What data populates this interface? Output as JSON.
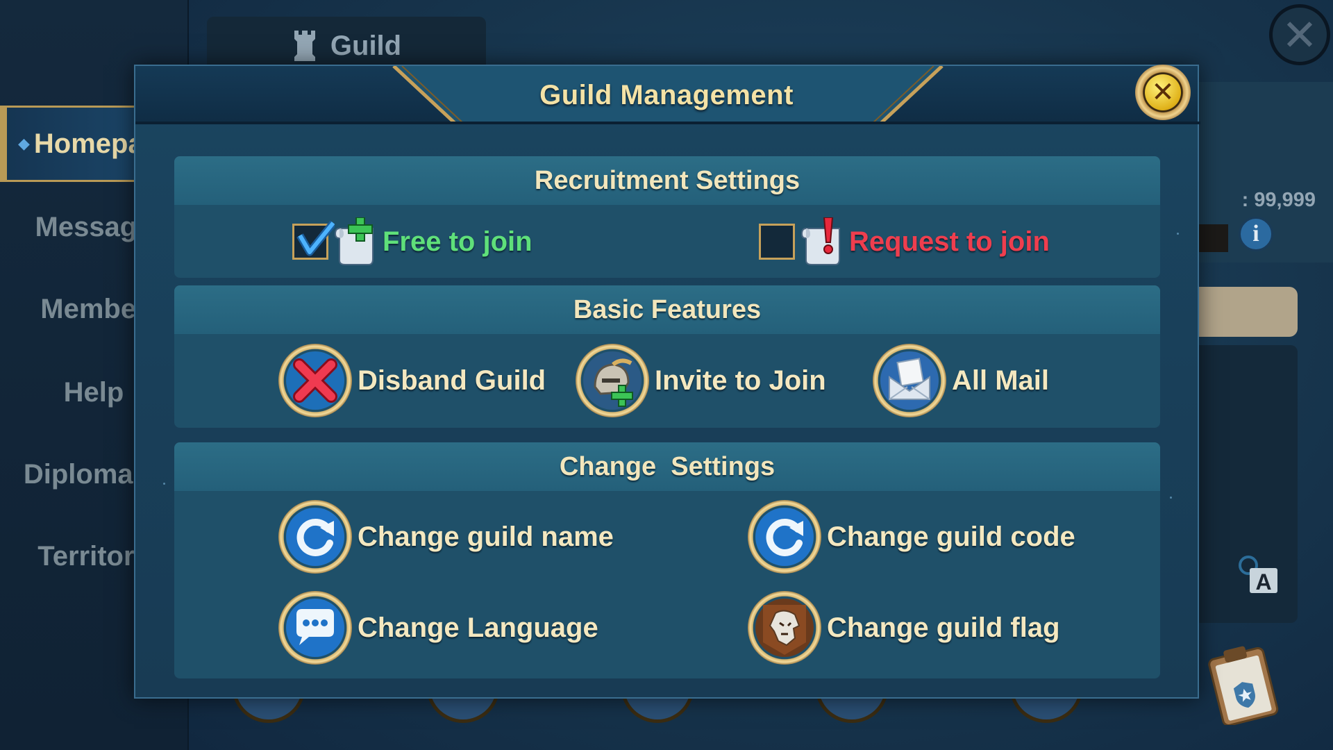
{
  "background": {
    "tab_title": "Guild",
    "sidebar": [
      {
        "label": "Homepage",
        "active": true
      },
      {
        "label": "Message",
        "active": false
      },
      {
        "label": "Member",
        "active": false
      },
      {
        "label": "Help",
        "active": false
      },
      {
        "label": "Diplomacy",
        "active": false
      },
      {
        "label": "Territory",
        "active": false
      }
    ],
    "score_text": ": 99,999",
    "info_glyph": "i",
    "translate_glyph": "A",
    "close_glyph": "✕"
  },
  "modal": {
    "title": "Guild Management",
    "close_glyph": "✕",
    "recruitment": {
      "heading": "Recruitment Settings",
      "free_to_join": {
        "label": "Free to join",
        "checked": true,
        "color": "#5fe07a"
      },
      "request_to_join": {
        "label": "Request to join",
        "checked": false,
        "color": "#ee3e4e"
      }
    },
    "basic": {
      "heading": "Basic Features",
      "items": [
        {
          "label": "Disband Guild",
          "icon": "red-x-icon"
        },
        {
          "label": "Invite to Join",
          "icon": "knight-plus-icon"
        },
        {
          "label": "All Mail",
          "icon": "envelope-icon"
        }
      ]
    },
    "change": {
      "heading": "Change  Settings",
      "items": [
        {
          "label": "Change guild name",
          "icon": "refresh-icon"
        },
        {
          "label": "Change guild code",
          "icon": "refresh-icon"
        },
        {
          "label": "Change Language",
          "icon": "speech-bubble-icon"
        },
        {
          "label": "Change guild flag",
          "icon": "lion-flag-icon"
        }
      ]
    }
  },
  "colors": {
    "gold_text": "#f4e2a6",
    "accent_gold": "#c7a15a",
    "panel_blue": "#1f5069"
  }
}
